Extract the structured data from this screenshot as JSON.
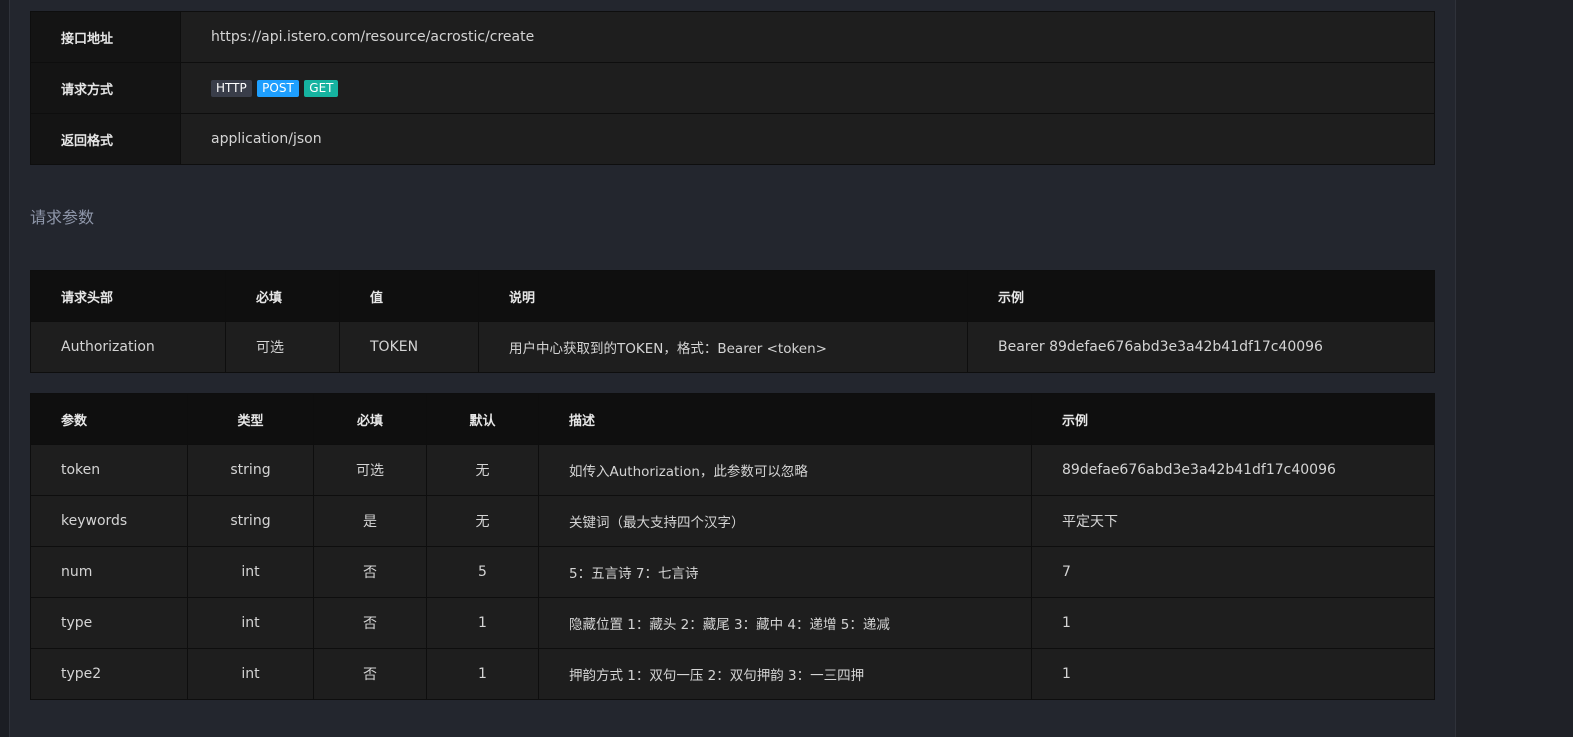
{
  "api_info": {
    "endpoint_label": "接口地址",
    "endpoint_value": "https://api.istero.com/resource/acrostic/create",
    "method_label": "请求方式",
    "method_tags": [
      "HTTP",
      "POST",
      "GET"
    ],
    "format_label": "返回格式",
    "format_value": "application/json"
  },
  "section_title": "请求参数",
  "header_table": {
    "columns": [
      "请求头部",
      "必填",
      "值",
      "说明",
      "示例"
    ],
    "row": {
      "name": "Authorization",
      "required": "可选",
      "value": "TOKEN",
      "desc": "用户中心获取到的TOKEN，格式：Bearer <token>",
      "example": "Bearer 89defae676abd3e3a42b41df17c40096"
    }
  },
  "params_table": {
    "columns": [
      "参数",
      "类型",
      "必填",
      "默认",
      "描述",
      "示例"
    ],
    "rows": [
      {
        "name": "token",
        "type": "string",
        "required": "可选",
        "default": "无",
        "desc": "如传入Authorization，此参数可以忽略",
        "example": "89defae676abd3e3a42b41df17c40096"
      },
      {
        "name": "keywords",
        "type": "string",
        "required": "是",
        "default": "无",
        "desc": "关键词（最大支持四个汉字）",
        "example": "平定天下"
      },
      {
        "name": "num",
        "type": "int",
        "required": "否",
        "default": "5",
        "desc": "5：五言诗 7：七言诗",
        "example": "7"
      },
      {
        "name": "type",
        "type": "int",
        "required": "否",
        "default": "1",
        "desc": "隐藏位置 1：藏头 2：藏尾 3：藏中 4：递增 5：递减",
        "example": "1"
      },
      {
        "name": "type2",
        "type": "int",
        "required": "否",
        "default": "1",
        "desc": "押韵方式 1：双句一压 2：双句押韵 3：一三四押",
        "example": "1"
      }
    ]
  },
  "colors": {
    "background": "#23262e",
    "tag_http": "#393d49",
    "tag_post": "#1e9fff",
    "tag_get": "#16b3a0",
    "section_title": "#8f97aa"
  }
}
